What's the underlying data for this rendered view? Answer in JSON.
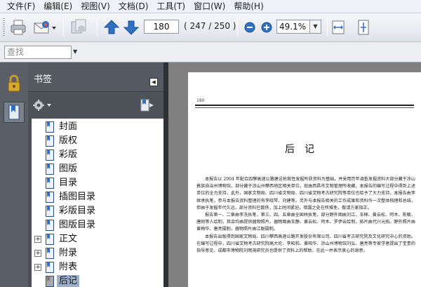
{
  "menu": [
    "文件(F)",
    "编辑(E)",
    "视图(V)",
    "文档(D)",
    "工具(T)",
    "窗口(W)",
    "帮助(H)"
  ],
  "toolbar": {
    "current_page": "180",
    "page_count": "( 247 / 250 )",
    "zoom": "49.1%",
    "icons": [
      "print-icon",
      "email-icon",
      "collaborate-icon",
      "prev-page-icon",
      "next-page-icon",
      "zoom-out-icon",
      "zoom-in-icon",
      "fit-width-icon",
      "fit-page-icon"
    ]
  },
  "find": {
    "placeholder": "查找"
  },
  "panel": {
    "title": "书签",
    "bookmarks": [
      {
        "label": "封面",
        "expandable": false
      },
      {
        "label": "版权",
        "expandable": false
      },
      {
        "label": "彩版",
        "expandable": false
      },
      {
        "label": "图版",
        "expandable": false
      },
      {
        "label": "目录",
        "expandable": false
      },
      {
        "label": "插图目录",
        "expandable": false
      },
      {
        "label": "彩版目录",
        "expandable": false
      },
      {
        "label": "图版目录",
        "expandable": false
      },
      {
        "label": "正文",
        "expandable": true
      },
      {
        "label": "附录",
        "expandable": true
      },
      {
        "label": "附表",
        "expandable": true
      },
      {
        "label": "后记",
        "expandable": false,
        "selected": true
      }
    ]
  },
  "document": {
    "page_number": "180",
    "heading": "后记",
    "paragraphs": [
      "本报告以 2004 年配合四攀高速公路建设抢救性发掘所获资料为基础，并采用历年调查发掘资料大部分藏于凉山彝族自治州博物馆，部分藏于凉山州攀西地区相关单位，现由西昌市文物管理所收藏。本报告的编写过程中得到上述单位的全力支持，此外，国家文物局、四川省文物局、四川省文物考古研究院等单位也给予了大力支持，本报告由李继承执笔，参与本报告资料整理的有李晓琴、刘建等。另外与本报告相关的工作成果和资料作一次整体梳理和总结，但由于发掘年代久远、部分资料已散佚，加上时间紧迫，错漏之处在所难免，敬请方家指正。",
      "报告第一、二章由李冼执笔，第三、四、五章由全国林执笔，部分野外图由刘江、王楠、黄云松、阿木、陈敏、唐刚等人绘制，其余均由提供器物照片。器物图由王静、黄云松、阿木、罗伊云绘制，拓片由代兴元拓。野外照片由黄梅华、唐亮摄制，器物照片由江聪摄制。",
      "本报告出版得到国家文物局、四川攀西高速公路开发股份有限公司、四川省考古研究院及文化研究中心的资助。在编写过程中，四川省文物考古研究院高大伦、李昭和、黄昭华、凉山州博物馆刘弘、唐亮等专家学者提出了宝贵的指导意见，成都市博物院刘雨茂研究员也提供了资料上的帮助，在此一并表示衷心的谢意。"
    ]
  },
  "colors": {
    "panel_bg": "#4a4e55",
    "selection": "#9ab0cc",
    "doc_bg": "#808080",
    "accent_blue": "#2f6fc4"
  }
}
